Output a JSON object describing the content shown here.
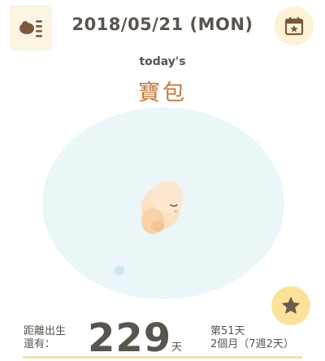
{
  "header": {
    "date_title": "2018/05/21 (MON)",
    "menu_icon": "baby-list-icon",
    "calendar_icon": "calendar-star-icon"
  },
  "main": {
    "subtitle": "today's",
    "baby_name": "寶包",
    "illustration": "fetus-illustration"
  },
  "favorite": {
    "icon": "star-icon"
  },
  "countdown": {
    "label_line1": "距離出生",
    "label_line2": "還有：",
    "days": "229",
    "unit": "天",
    "day_count": "第51天",
    "age": "2個月（7週2天）"
  },
  "colors": {
    "accent": "#c27a3a",
    "bubble": "#eaf6f7",
    "star_button": "#fbe19a",
    "calendar_button": "#fdf1d6",
    "text": "#5a544e"
  }
}
